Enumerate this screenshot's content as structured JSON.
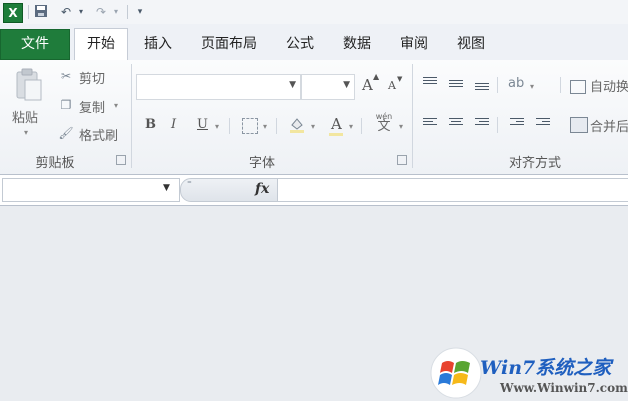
{
  "quick_access": {
    "app_icon": "excel-icon",
    "save_icon": "save-icon",
    "undo_icon": "undo-icon",
    "redo_icon": "redo-icon",
    "customize_icon": "customize-icon"
  },
  "tabs": [
    {
      "label": "文件"
    },
    {
      "label": "开始"
    },
    {
      "label": "插入"
    },
    {
      "label": "页面布局"
    },
    {
      "label": "公式"
    },
    {
      "label": "数据"
    },
    {
      "label": "审阅"
    },
    {
      "label": "视图"
    }
  ],
  "ribbon": {
    "clipboard": {
      "paste": "粘贴",
      "cut": "剪切",
      "copy": "复制",
      "format_painter": "格式刷",
      "group_label": "剪贴板"
    },
    "font": {
      "font_name": "",
      "font_size": "",
      "grow": "A",
      "shrink": "A",
      "bold": "B",
      "italic": "I",
      "underline": "U",
      "font_color": "A",
      "phonetic": "wén",
      "group_label": "字体"
    },
    "alignment": {
      "wrap_text": "自动换",
      "merge_center": "合并后",
      "group_label": "对齐方式"
    }
  },
  "formula_bar": {
    "name_box": "",
    "fx_label": "fx",
    "formula": ""
  },
  "watermark": {
    "brand": "Win7系统之家",
    "url": "Www.Winwin7.com"
  },
  "colors": {
    "file_tab": "#1f7c3b",
    "ribbon_bg": "#f3f5f8"
  }
}
